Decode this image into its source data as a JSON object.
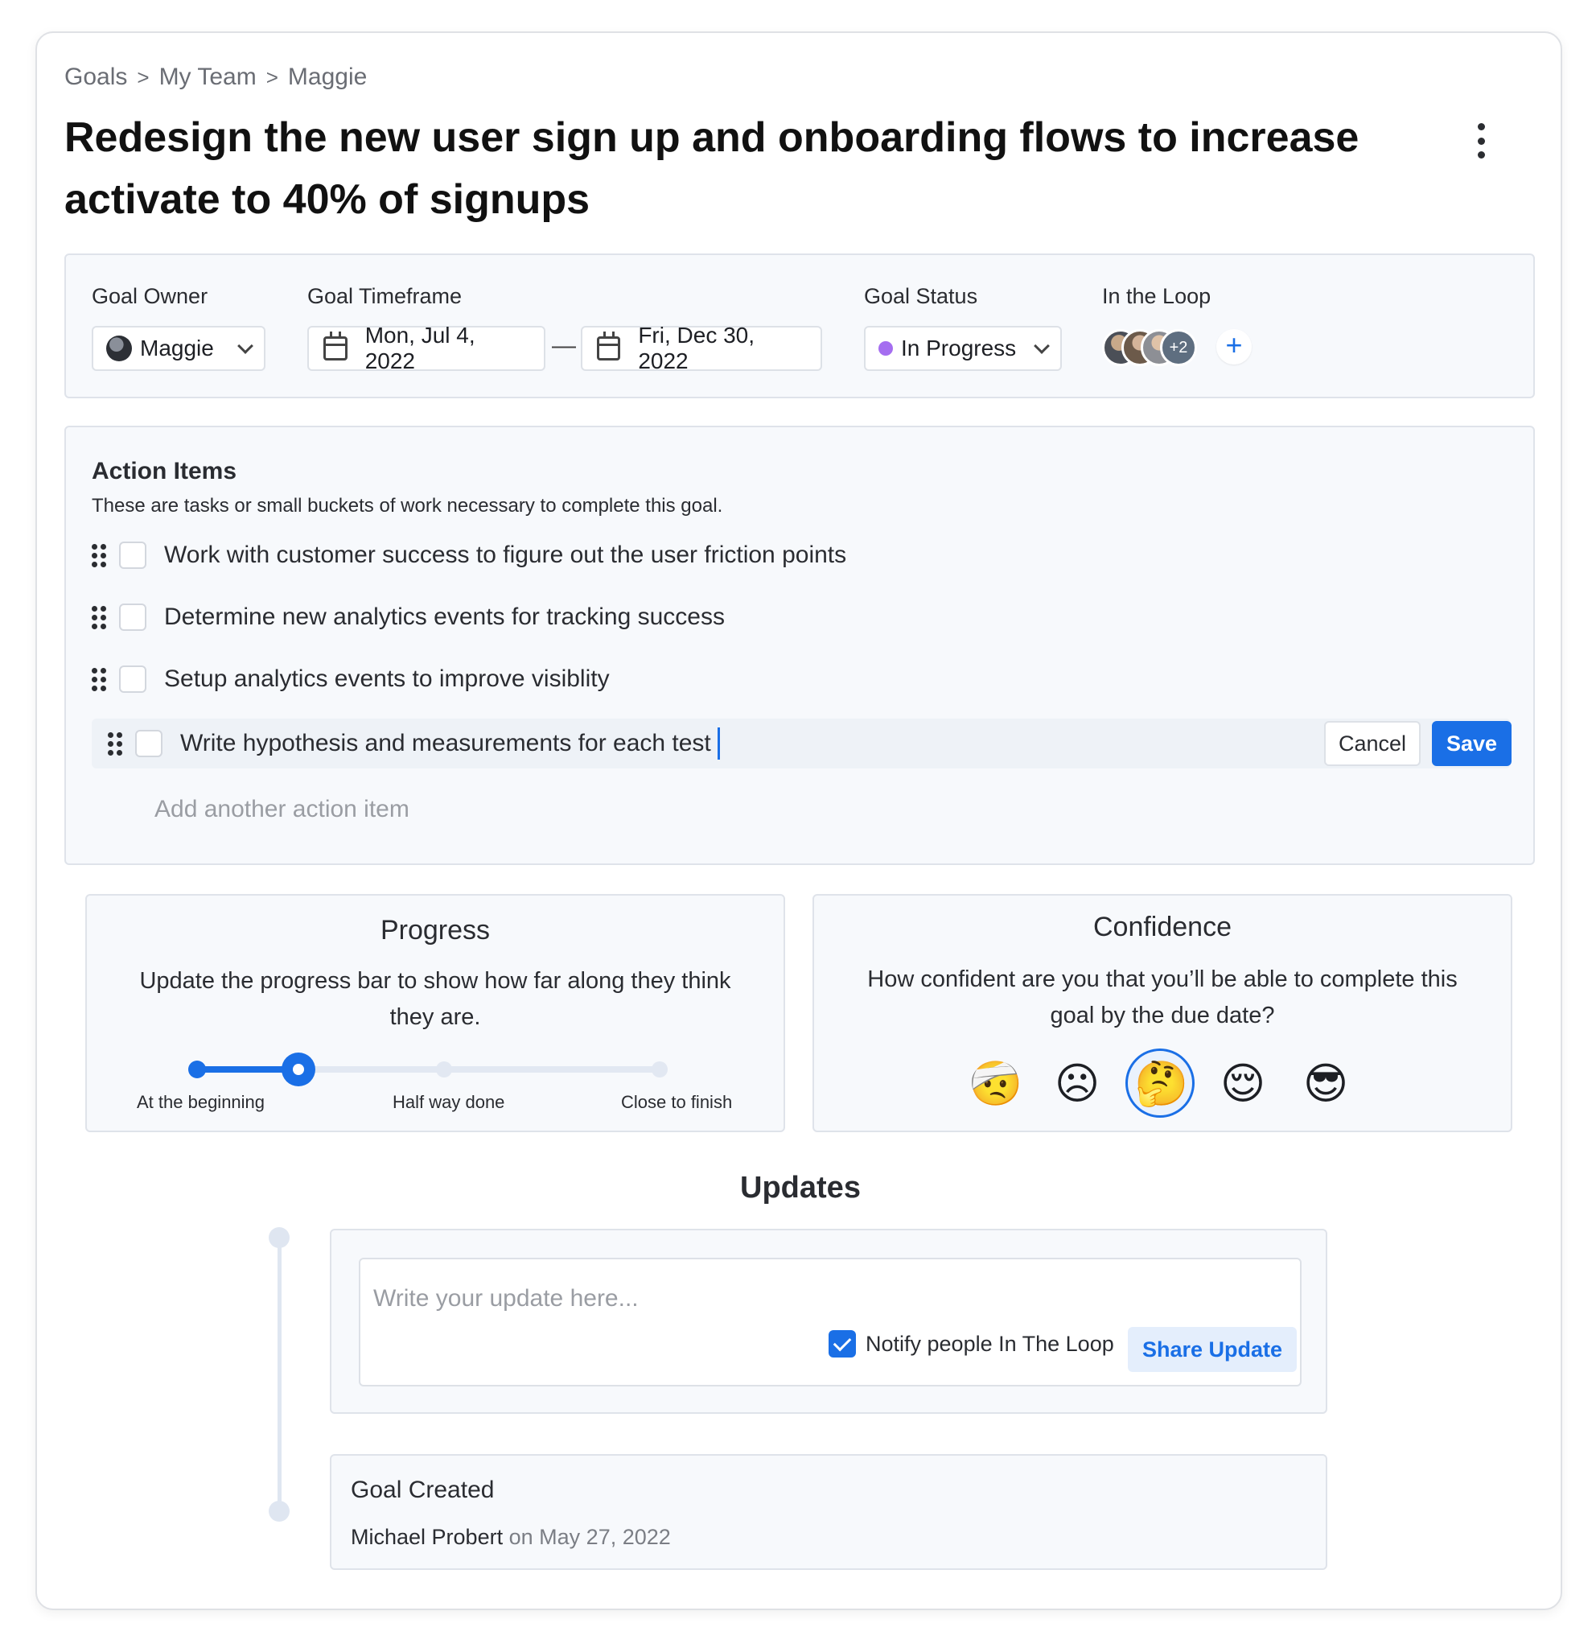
{
  "breadcrumb": [
    "Goals",
    "My Team",
    "Maggie"
  ],
  "breadcrumb_separator": ">",
  "title": "Redesign the new user sign up and onboarding flows to increase activate to 40% of signups",
  "meta": {
    "owner_label": "Goal Owner",
    "owner_value": "Maggie",
    "timeframe_label": "Goal Timeframe",
    "start_date": "Mon, Jul 4, 2022",
    "date_separator": "—",
    "end_date": "Fri, Dec 30, 2022",
    "status_label": "Goal Status",
    "status_value": "In Progress",
    "status_color": "#a56ef0",
    "loop_label": "In the Loop",
    "loop_extra": "+2"
  },
  "actions": {
    "title": "Action Items",
    "subtitle": "These are tasks or small buckets of work necessary to complete this goal.",
    "items": [
      "Work with customer success to figure out the user friction points",
      "Determine new analytics events for tracking success",
      "Setup analytics events to improve visiblity"
    ],
    "editing_value": "Write hypothesis and measurements for each test",
    "cancel_label": "Cancel",
    "save_label": "Save",
    "add_placeholder": "Add another action item"
  },
  "progress": {
    "title": "Progress",
    "description": "Update the progress bar to show how far along they think they are.",
    "labels": [
      "At the beginning",
      "Half way done",
      "Close to finish"
    ],
    "value": 0.22
  },
  "confidence": {
    "title": "Confidence",
    "question": "How confident are you that you’ll be able to complete this goal by the due date?",
    "options": [
      "🤕",
      "☹",
      "🤔",
      "😌",
      "😎"
    ],
    "selected_index": 2
  },
  "updates": {
    "title": "Updates",
    "placeholder": "Write your update here...",
    "notify_label": "Notify people In The Loop",
    "notify_checked": true,
    "share_label": "Share Update",
    "created_title": "Goal Created",
    "created_by": "Michael Probert",
    "created_on_word": "on",
    "created_date": "May 27, 2022"
  },
  "colors": {
    "accent": "#1a6fe6",
    "panel_bg": "#f7f9fc",
    "border": "#dfe3ea"
  }
}
